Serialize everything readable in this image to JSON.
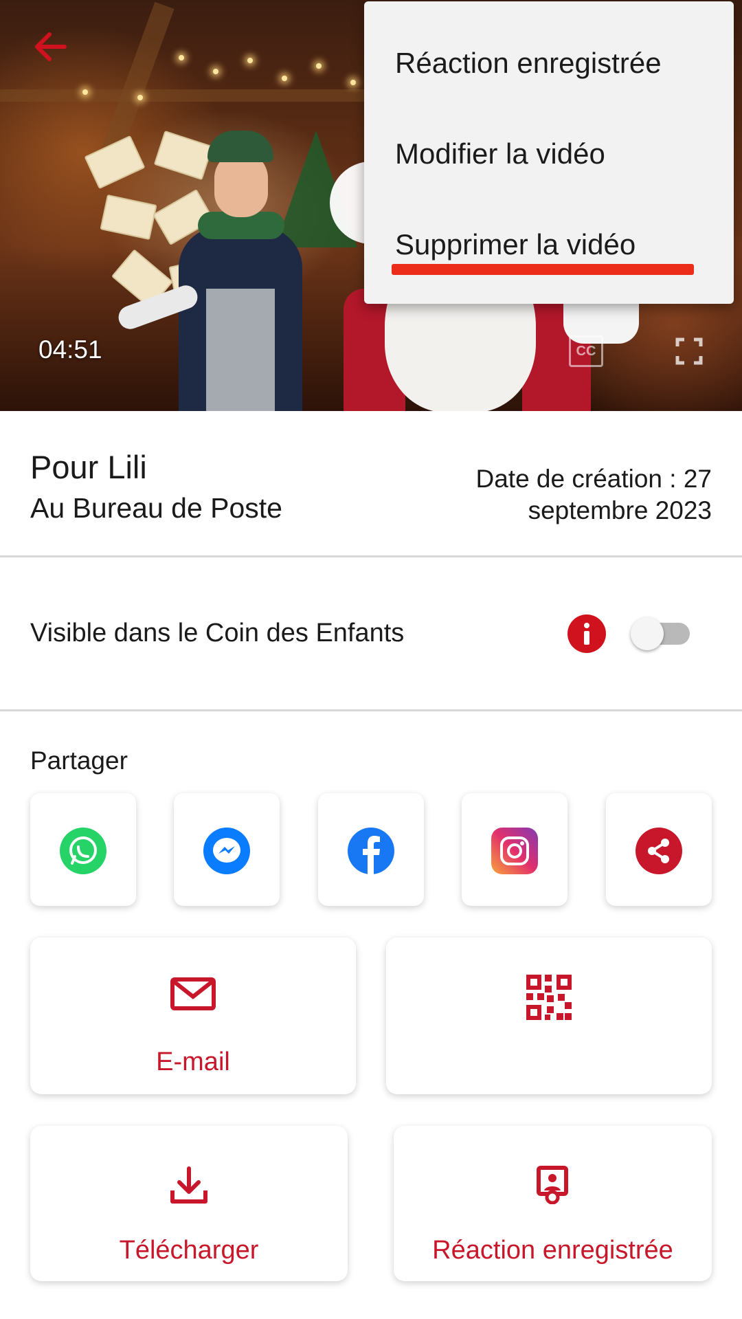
{
  "video": {
    "duration": "04:51",
    "cc_label": "CC"
  },
  "menu": {
    "items": [
      {
        "label": "Réaction enregistrée"
      },
      {
        "label": "Modifier la vidéo"
      },
      {
        "label": "Supprimer la vidéo"
      }
    ]
  },
  "info": {
    "title": "Pour Lili",
    "subtitle": "Au Bureau de Poste",
    "created_line1": "Date de création : 27",
    "created_line2": "septembre 2023"
  },
  "visibility": {
    "label": "Visible dans le Coin des Enfants",
    "toggle_on": false
  },
  "share": {
    "label": "Partager",
    "targets": [
      {
        "name": "whatsapp-icon",
        "color": "#25d366"
      },
      {
        "name": "messenger-icon",
        "color": "#0a7cff"
      },
      {
        "name": "facebook-icon",
        "color": "#1877f2"
      },
      {
        "name": "instagram-icon",
        "color": "#e1306c"
      },
      {
        "name": "share-icon",
        "color": "#c8172a"
      }
    ]
  },
  "actions": {
    "email": "E-mail",
    "qr": "",
    "download": "Télécharger",
    "reaction": "Réaction enregistrée"
  },
  "colors": {
    "accent": "#c8172a",
    "menu_highlight": "#ec2d1a"
  }
}
